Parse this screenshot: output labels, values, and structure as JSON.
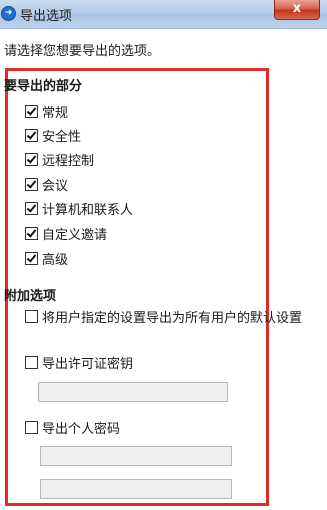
{
  "window": {
    "title": "导出选项",
    "close_glyph": "x"
  },
  "prompt": "请选择您想要导出的选项。",
  "export_section": {
    "heading": "要导出的部分",
    "items": [
      {
        "label": "常规",
        "checked": true
      },
      {
        "label": "安全性",
        "checked": true
      },
      {
        "label": "远程控制",
        "checked": true
      },
      {
        "label": "会议",
        "checked": true
      },
      {
        "label": "计算机和联系人",
        "checked": true
      },
      {
        "label": "自定义邀请",
        "checked": true
      },
      {
        "label": "高级",
        "checked": true
      }
    ]
  },
  "additional_section": {
    "heading": "附加选项",
    "default_settings_label": "将用户指定的设置导出为所有用户的默认设置",
    "license_key_label": "导出许可证密钥",
    "license_key_value": "",
    "personal_password_label": "导出个人密码",
    "personal_password_value": "",
    "personal_password_confirm_value": ""
  },
  "colors": {
    "highlight": "#e52a2a",
    "titlebar": "#b5cde9"
  }
}
